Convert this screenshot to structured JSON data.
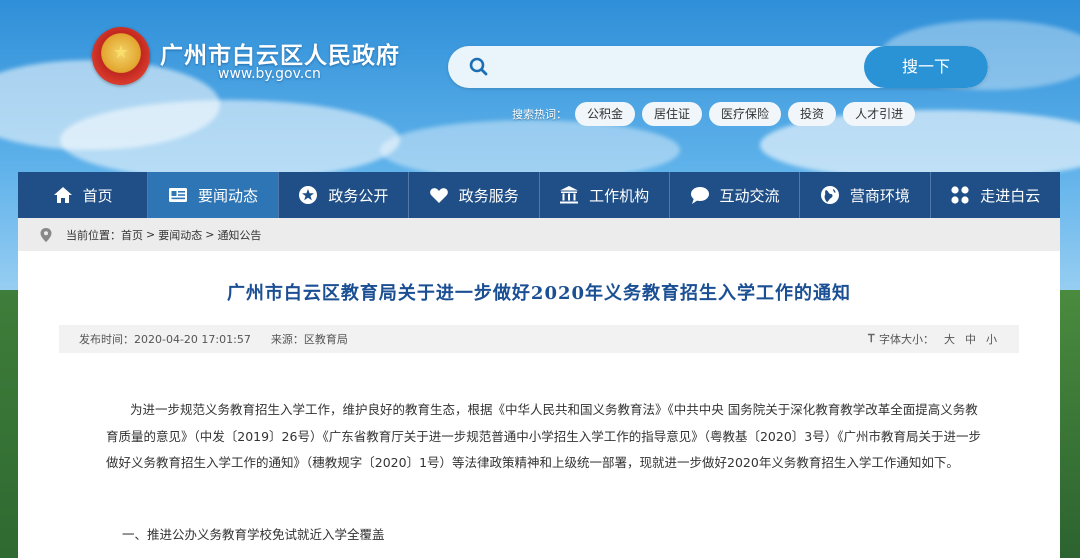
{
  "header": {
    "site_title": "广州市白云区人民政府",
    "site_url": "www.by.gov.cn"
  },
  "search": {
    "placeholder": "",
    "button_label": "搜一下"
  },
  "hot_search": {
    "label": "搜索热词：",
    "tags": [
      "公积金",
      "居住证",
      "医疗保险",
      "投资",
      "人才引进"
    ]
  },
  "nav": {
    "items": [
      {
        "label": "首页",
        "icon": "home-icon"
      },
      {
        "label": "要闻动态",
        "icon": "news-icon"
      },
      {
        "label": "政务公开",
        "icon": "star-icon"
      },
      {
        "label": "政务服务",
        "icon": "heart-icon"
      },
      {
        "label": "工作机构",
        "icon": "building-icon"
      },
      {
        "label": "互动交流",
        "icon": "chat-icon"
      },
      {
        "label": "营商环境",
        "icon": "globe-icon"
      },
      {
        "label": "走进白云",
        "icon": "grid-icon"
      }
    ],
    "active_index": 1,
    "colors": {
      "bar": "#1f4f86",
      "active": "#2e75b6"
    }
  },
  "breadcrumb": {
    "label": "当前位置：",
    "items": [
      "首页",
      "要闻动态",
      "通知公告"
    ],
    "separator": ">"
  },
  "article": {
    "title": "广州市白云区教育局关于进一步做好2020年义务教育招生入学工作的通知",
    "publish_time": "发布时间：2020-04-20 17:01:57",
    "source": "来源：区教育局",
    "font_size_label": "字体大小：",
    "font_sizes": [
      "大",
      "中",
      "小"
    ],
    "paragraph": "为进一步规范义务教育招生入学工作，维护良好的教育生态，根据《中华人民共和国义务教育法》《中共中央 国务院关于深化教育教学改革全面提高义务教育质量的意见》（中发〔2019〕26号）《广东省教育厅关于进一步规范普通中小学招生入学工作的指导意见》（粤教基〔2020〕3号）《广州市教育局关于进一步做好义务教育招生入学工作的通知》（穗教规字〔2020〕1号）等法律政策精神和上级统一部署，现就进一步做好2020年义务教育招生入学工作通知如下。",
    "section_heading": "一、推进公办义务教育学校免试就近入学全覆盖"
  }
}
